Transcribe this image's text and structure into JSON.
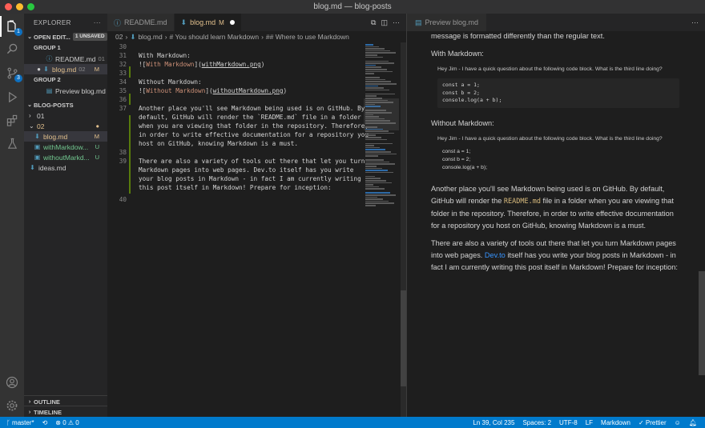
{
  "window": {
    "title": "blog.md — blog-posts",
    "traffic_colors": [
      "#ff5f57",
      "#febc2e",
      "#28c840"
    ]
  },
  "activity_bar": {
    "items": [
      {
        "icon": "files-icon",
        "badge": "1"
      },
      {
        "icon": "search-icon"
      },
      {
        "icon": "source-control-icon",
        "badge": "3"
      },
      {
        "icon": "run-debug-icon"
      },
      {
        "icon": "extensions-icon"
      },
      {
        "icon": "testing-icon"
      }
    ],
    "bottom": [
      {
        "icon": "account-icon"
      },
      {
        "icon": "settings-gear-icon"
      }
    ]
  },
  "sidebar": {
    "title": "EXPLORER",
    "more": "···",
    "open_editors": {
      "label": "OPEN EDIT...",
      "unsaved_badge": "1 UNSAVED",
      "group1_label": "GROUP 1",
      "group1_items": [
        {
          "name": "README.md",
          "desc": "01"
        },
        {
          "name": "blog.md",
          "desc": "02",
          "status": "M"
        }
      ],
      "group2_label": "GROUP 2",
      "group2_items": [
        {
          "name": "Preview blog.md"
        }
      ]
    },
    "folder": {
      "label": "BLOG-POSTS",
      "items": [
        {
          "name": "01",
          "kind": "folder-collapsed"
        },
        {
          "name": "02",
          "kind": "folder-open",
          "status": "●"
        },
        {
          "name": "blog.md",
          "status": "M"
        },
        {
          "name": "withMarkdow...",
          "status": "U"
        },
        {
          "name": "withoutMarkd...",
          "status": "U"
        },
        {
          "name": "ideas.md"
        }
      ]
    },
    "outline": "OUTLINE",
    "timeline": "TIMELINE"
  },
  "editor": {
    "tabs": [
      {
        "label": "README.md",
        "active": false
      },
      {
        "label": "blog.md",
        "status": "M",
        "active": true
      }
    ],
    "breadcrumb": [
      "02",
      "blog.md",
      "# You should learn Markdown",
      "## Where to use Markdown"
    ],
    "lines": [
      {
        "n": "30",
        "text": ""
      },
      {
        "n": "31",
        "text": "With Markdown:"
      },
      {
        "n": "32",
        "text_parts": [
          "![",
          "With Markdown",
          "](",
          "withMarkdown.png",
          ")"
        ]
      },
      {
        "n": "33",
        "text": ""
      },
      {
        "n": "34",
        "text": "Without Markdown:"
      },
      {
        "n": "35",
        "text_parts": [
          "![",
          "Without Markdown",
          "](",
          "withoutMarkdown.png",
          ")"
        ]
      },
      {
        "n": "36",
        "text": ""
      },
      {
        "n": "37",
        "wrapped": [
          "Another place you'll see Markdown being used is on GitHub. By",
          "default, GitHub will render the `README.md` file in a folder",
          "when you are viewing that folder in the repository. Therefore,",
          "in order to write effective documentation for a repository you",
          "host on GitHub, knowing Markdown is a must."
        ]
      },
      {
        "n": "38",
        "text": ""
      },
      {
        "n": "39",
        "wrapped": [
          "There are also a variety of tools out there that let you turn",
          "Markdown pages into web pages. Dev.to itself has you write",
          "your blog posts in Markdown - in fact I am currently writing",
          "this post itself in Markdown! Prepare for inception:"
        ]
      },
      {
        "n": "40",
        "text": ""
      }
    ]
  },
  "preview": {
    "tab_label": "Preview blog.md",
    "intro_tail": "message is formatted differently than the regular text.",
    "with_label": "With Markdown:",
    "question": "Hey Jim - I have a quick question about the following code block. What is the third line doing?",
    "code_lines": [
      "const a = 1;",
      "const b = 2;",
      "console.log(a + b);"
    ],
    "without_label": "Without Markdown:",
    "question2": "Hey Jim - I have a quick question about the following code block. What is the third line doing?",
    "plain_lines": [
      "const a = 1;",
      "const b = 2;",
      "console.log(a + b);"
    ],
    "para1_a": "Another place you'll see Markdown being used is on GitHub. By default, GitHub will render the ",
    "para1_code": "README.md",
    "para1_b": " file in a folder when you are viewing that folder in the repository. Therefore, in order to write effective documentation for a repository you host on GitHub, knowing Markdown is a must.",
    "para2_a": "There are also a variety of tools out there that let you turn Markdown pages into web pages. ",
    "para2_link": "Dev.to",
    "para2_b": " itself has you write your blog posts in Markdown - in fact I am currently writing this post itself in Markdown! Prepare for inception:"
  },
  "status_bar": {
    "branch": "master*",
    "sync": "⟲",
    "problems": "⊗ 0 ⚠ 0",
    "position": "Ln 39, Col 235",
    "spaces": "Spaces: 2",
    "encoding": "UTF-8",
    "eol": "LF",
    "language": "Markdown",
    "formatter": "✓ Prettier",
    "colors": {
      "bg": "#007acc"
    }
  }
}
